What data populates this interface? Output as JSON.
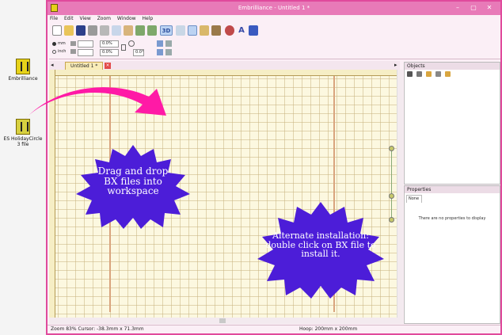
{
  "desktop": {
    "icons": [
      {
        "label": "Embrilliance",
        "icon": "embrilliance-app-icon"
      },
      {
        "label": "ES HolidayCircle 3 file",
        "icon": "bx-file-icon"
      }
    ]
  },
  "window": {
    "title": "Embrilliance - Untitled 1 *",
    "controls": [
      "–",
      "▢",
      "✕"
    ]
  },
  "menu": [
    "File",
    "Edit",
    "View",
    "Zoom",
    "Window",
    "Help"
  ],
  "toolbar": {
    "three_d_label": "3D",
    "text_tool_label": "A"
  },
  "options": {
    "unit_mm": "mm",
    "unit_inch": "inch",
    "width_value": "0.0%",
    "height_value": "0.0%",
    "rotate_value": "0.0°"
  },
  "tabs": [
    {
      "label": "Untitled 1 *"
    }
  ],
  "panels": {
    "objects_title": "Objects",
    "properties_title": "Properties",
    "properties_tab": "None",
    "properties_empty": "There are no properties to display"
  },
  "status": {
    "left": "Zoom 83%  Cursor: -38.3mm x 71.3mm",
    "hoop": "Hoop: 200mm x 200mm"
  },
  "annotations": {
    "drag_drop_lines": [
      "Drag and drop",
      "BX files into",
      "workspace"
    ],
    "alternate_lines": [
      "Alternate installation:",
      "double click on BX file to",
      "install it."
    ]
  },
  "colors": {
    "accent": "#e04a9c",
    "arrow": "#ff1aa6",
    "burst": "#4c1dd8"
  }
}
